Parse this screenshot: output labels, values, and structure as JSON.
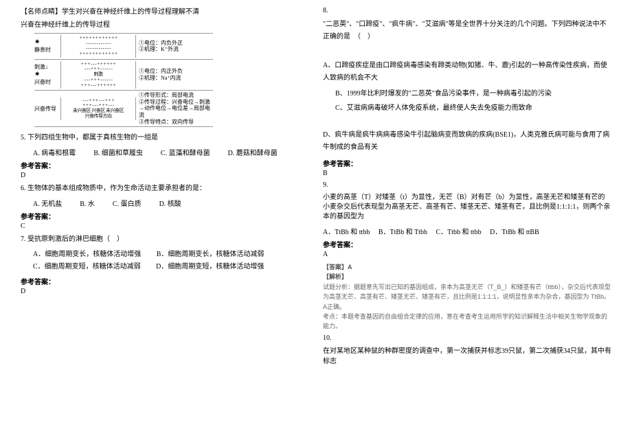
{
  "left": {
    "intro1": "【名师点睛】学生对兴奋在神经纤维上的传导过程理解不清",
    "intro2": "兴奋在神经纤维上的传导过程",
    "diagram": {
      "rows": [
        {
          "label": "静息时",
          "burst": "✷",
          "box_top": "+ + + + + + + + + + + +",
          "box_mid": "- - - - - - - - - - - -",
          "box_bot": "+ + + + + + + + + + + +",
          "note1": "①电位：内负外正",
          "note2": "②机理：K⁺外流"
        },
        {
          "label": "兴奋时",
          "arrow": "刺激↓",
          "burst": "✷",
          "box_top": "+ + + - - - + + + + + +",
          "box_mid": "- - - + + + - - - - - -",
          "box_bot": "+ + + - - - + + + + + +",
          "sublabel": "刺激",
          "note1": "①电位：内正外负",
          "note2": "②机理：Na⁺内流"
        },
        {
          "label": "兴奋传导",
          "box_top": "- - - + + + - - - + + +",
          "box_bot": "+ + + - - - + + + - - -",
          "zones": "未兴奋区 兴奋区 未兴奋区",
          "subarrow": "兴奋传导方向",
          "note1": "①传导形式：局部电流",
          "note2": "②传导过程：兴奋电位→刺激→动作电位→电位差→局部电流",
          "note3": "③传导特点：双向传导"
        }
      ]
    },
    "q5": {
      "text": "5. 下列四组生物中，都属于真核生物的一组是",
      "a": "A. 病毒和根霉",
      "b": "B. 细菌和草履虫",
      "c": "C. 蓝藻和酵母菌",
      "d": "D. 蘑菇和酵母菌",
      "ans_label": "参考答案：",
      "ans": "D"
    },
    "q6": {
      "text": "6. 生物体的基本组成物质中，作为生命活动主要承担者的是：",
      "a": "A. 无机盐",
      "b": "B. 水",
      "c": "C. 蛋白质",
      "d": "D. 核酸",
      "ans_label": "参考答案：",
      "ans": "C"
    },
    "q7": {
      "text": "7. 受抗原刺激后的淋巴细胞（　）",
      "a": "A．细胞周期变长，核糖体活动增强",
      "b": "B．细胞周期变长，核糖体活动减弱",
      "c": "C．细胞周期变短，核糖体活动减弱",
      "d": "D．细胞周期变短，核糖体活动增强",
      "ans_label": "参考答案：",
      "ans": "D"
    }
  },
  "right": {
    "q8": {
      "num": "8.",
      "text": "\"二恶英\"、\"口蹄疫\"、\"疯牛病\"、\"艾滋病\"等是全世界十分关注的几个问题。下列四种说法中不正确的是　（　）",
      "a": "A、口蹄疫疾症是由口蹄疫病毒感染有蹄类动物(如猪、牛、鹿)引起的一种高传染性疾病，而使人致病的机会不大",
      "b": "B、1999年比利时爆发的\"二恶英\"食品污染事件，是一种病毒引起的污染",
      "c": "C、艾滋病病毒破坏人体免疫系统，最终使人失去免疫能力而致命",
      "d": "D、疯牛病是疯牛病病毒感染牛引起脑病变而致病的疾病(BSE1)，人类克雅氏病可能与食用了病牛制成的食品有关",
      "ans_label": "参考答案：",
      "ans": "B"
    },
    "q9": {
      "num": "9.",
      "text": "小麦的高茎（T）对矮茎（t）为显性，无芒（B）对有芒（b）为显性，高茎无芒和矮茎有芒的小麦杂交后代表现型为高茎无芒、高茎有芒、矮茎无芒、矮茎有芒，且比例是1:1:1:1，则两个亲本的基因型为",
      "a": "A．TtBb 和 ttbb",
      "b": "B．TtBb 和 Ttbb",
      "c": "C．Ttbb 和 ttbb",
      "d": "D．TtBb 和 ttBB",
      "ans_label": "参考答案：",
      "ans": "A",
      "ans2": "【答案】A",
      "analysis_label": "【解析】",
      "analysis": "试题分析：据题意先写出已知的基因组成，亲本为高茎无芒（T_B_）和矮茎有芒（ttbb），杂交后代表现型为高茎无芒、高茎有芒、矮茎无芒、矮茎有芒，且比例是1:1:1:1，说明显性亲本为杂合，基因型为 TtBb。A正确。",
      "note": "考点：本题考查基因的自由组合定律的应用，意在考查考生运用所学的知识解释生活中相关生物学现象的能力。"
    },
    "q10": {
      "num": "10.",
      "text": "在对某地区某种鼠的种群密度的调查中，第一次捕获并标志39只鼠，第二次捕获34只鼠，其中有标志"
    }
  }
}
